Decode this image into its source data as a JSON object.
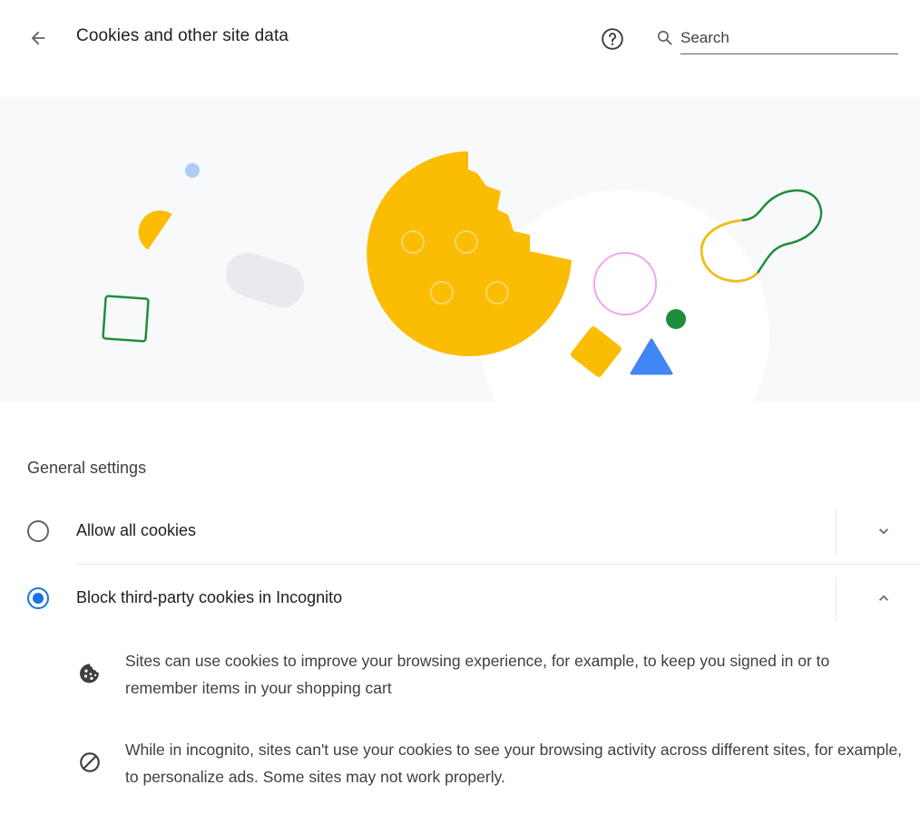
{
  "header": {
    "title": "Cookies and other site data",
    "back_icon": "arrow-back-icon",
    "help_icon": "help-circle-icon",
    "search": {
      "icon": "search-icon",
      "placeholder": "Search",
      "value": ""
    }
  },
  "banner": {
    "illustration": "cookie-illustration",
    "colors": {
      "yellow": "#fbbc04",
      "green": "#1e8e3e",
      "blue": "#4285f4",
      "light_blue": "#aecbfa",
      "pink": "#f1a6ef",
      "gray": "#e8eaed",
      "background": "#f8f9fa"
    }
  },
  "general_settings": {
    "heading": "General settings",
    "options": [
      {
        "label": "Allow all cookies",
        "selected": false,
        "expanded": false,
        "expand_icon": "chevron-down-icon"
      },
      {
        "label": "Block third-party cookies in Incognito",
        "selected": true,
        "expanded": true,
        "expand_icon": "chevron-up-icon"
      }
    ],
    "details": [
      {
        "icon": "cookie-icon",
        "text": "Sites can use cookies to improve your browsing experience, for example, to keep you signed in or to remember items in your shopping cart"
      },
      {
        "icon": "block-icon",
        "text": "While in incognito, sites can't use your cookies to see your browsing activity across different sites, for example, to personalize ads. Some sites may not work properly."
      }
    ]
  },
  "colors": {
    "accent": "#1a73e8",
    "text_primary": "#202124",
    "text_secondary": "#3c4043",
    "icon": "#5f6368"
  }
}
